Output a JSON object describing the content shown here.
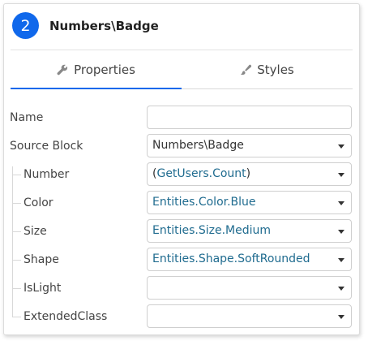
{
  "header": {
    "step_number": "2",
    "title": "Numbers\\Badge"
  },
  "tabs": [
    {
      "label": "Properties",
      "icon": "wrench-icon",
      "active": true
    },
    {
      "label": "Styles",
      "icon": "brush-icon",
      "active": false
    }
  ],
  "properties": {
    "name": {
      "label": "Name",
      "value": ""
    },
    "source_block": {
      "label": "Source Block",
      "value": "Numbers\\Badge"
    },
    "number": {
      "label": "Number",
      "open": "(",
      "value": "GetUsers.Count",
      "close": ")"
    },
    "color": {
      "label": "Color",
      "value": "Entities.Color.Blue"
    },
    "size": {
      "label": "Size",
      "value": "Entities.Size.Medium"
    },
    "shape": {
      "label": "Shape",
      "value": "Entities.Shape.SoftRounded"
    },
    "is_light": {
      "label": "IsLight",
      "value": ""
    },
    "extended_class": {
      "label": "ExtendedClass",
      "value": ""
    }
  },
  "colors": {
    "accent": "#1068eb",
    "link_value": "#1f6b8f"
  }
}
